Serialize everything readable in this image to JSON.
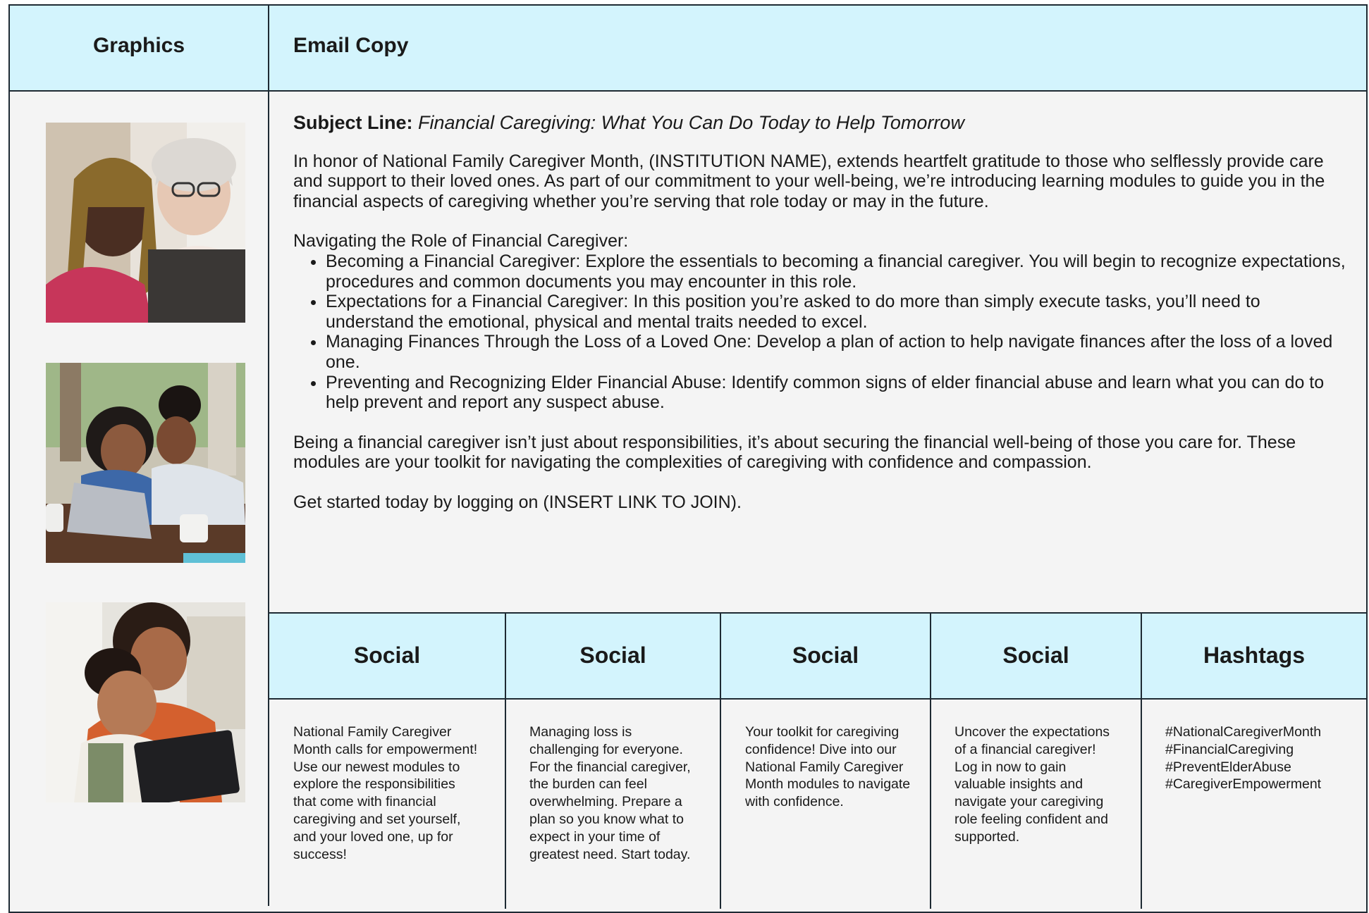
{
  "headers": {
    "graphics": "Graphics",
    "email_copy": "Email Copy"
  },
  "images": [
    {
      "icon": "photo-caregiver-daughter-elder-laptop"
    },
    {
      "icon": "photo-mother-daughter-laptop"
    },
    {
      "icon": "photo-mother-child-tablet"
    }
  ],
  "email": {
    "subject_label": "Subject Line:",
    "subject_text": "Financial Caregiving: What You Can Do Today to Help Tomorrow",
    "intro": "In honor of National Family Caregiver Month, (INSTITUTION NAME), extends heartfelt gratitude to those who selflessly provide care and support to their loved ones. As part of our commitment to your well-being, we’re introducing learning modules to guide you in the financial aspects of caregiving whether you’re serving that role today or may in the future.",
    "list_heading": "Navigating the Role of Financial Caregiver:",
    "bullets": [
      "Becoming a Financial Caregiver: Explore the essentials to becoming a financial caregiver. You will begin to recognize expectations, procedures and common documents you may encounter in this role.",
      "Expectations for a Financial Caregiver: In this position you’re asked to do more than simply execute tasks, you’ll need to understand the emotional, physical and mental traits needed to excel.",
      "Managing Finances Through the Loss of a Loved One: Develop a plan of action to help navigate finances after the loss of a loved one.",
      "Preventing and Recognizing Elder Financial Abuse: Identify common signs of elder financial abuse and learn what you can do to help prevent and report any suspect abuse."
    ],
    "closing": "Being a financial caregiver isn’t just about responsibilities, it’s about securing the financial well-being of those you care for. These modules are your toolkit for navigating the complexities of caregiving with confidence and compassion.",
    "cta": "Get started today by logging on (INSERT LINK TO JOIN)."
  },
  "social": {
    "headers": [
      "Social",
      "Social",
      "Social",
      "Social",
      "Hashtags"
    ],
    "posts": [
      "National Family Caregiver Month calls for empowerment! Use our newest modules to explore the responsibilities that come with financial caregiving and set yourself, and your loved one, up for success!",
      "Managing loss is challenging for everyone.  For the financial caregiver, the burden can feel overwhelming.  Prepare a plan so you know what to expect in your time of greatest need. Start today.",
      "Your toolkit for caregiving confidence! Dive into our National Family Caregiver Month modules to navigate with confidence.",
      "Uncover the expectations of a financial caregiver! Log in now to gain valuable insights and navigate your caregiving role feeling confident and supported."
    ],
    "hashtags": [
      "#NationalCaregiverMonth",
      "#FinancialCaregiving",
      "#PreventElderAbuse",
      "#CaregiverEmpowerment"
    ]
  }
}
